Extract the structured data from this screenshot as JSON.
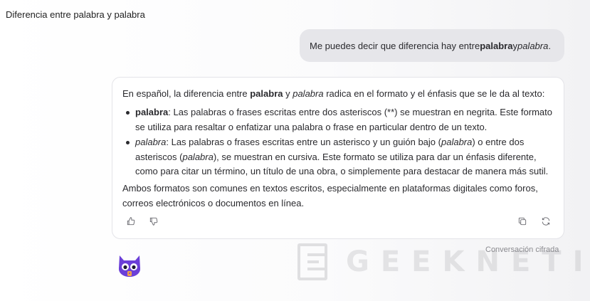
{
  "conversation": {
    "title": "Diferencia entre palabra y palabra"
  },
  "user_message": {
    "prefix": "Me puedes decir que diferencia hay entre ",
    "bold_word": "palabra",
    "middle": " y ",
    "italic_word": "palabra",
    "suffix": "."
  },
  "answer": {
    "intro": {
      "prefix": "En español, la diferencia entre ",
      "bold_word": "palabra",
      "middle": " y ",
      "italic_word": "palabra",
      "suffix": " radica en el formato y el énfasis que se le da al texto:"
    },
    "bullet_bold": {
      "term": "palabra",
      "text": ": Las palabras o frases escritas entre dos asteriscos (**) se muestran en negrita. Este formato se utiliza para resaltar o enfatizar una palabra o frase en particular dentro de un texto."
    },
    "bullet_italic": {
      "term": "palabra",
      "text_a": ": Las palabras o frases escritas entre un asterisco y un guión bajo (",
      "example_a": "palabra",
      "text_b": ") o entre dos asteriscos (",
      "example_b": "palabra",
      "text_c": "), se muestran en cursiva. Este formato se utiliza para dar un énfasis diferente, como para citar un término, un título de una obra, o simplemente para destacar de manera más sutil."
    },
    "closing": "Ambos formatos son comunes en textos escritos, especialmente en plataformas digitales como foros, correos electrónicos o documentos en línea."
  },
  "actions": {
    "thumbs_up": "thumbs-up-icon",
    "thumbs_down": "thumbs-down-icon",
    "copy": "copy-icon",
    "regenerate": "refresh-icon"
  },
  "status": {
    "encrypted": "Conversación cifrada"
  },
  "watermark": {
    "text": "GEEKNETIC"
  },
  "colors": {
    "user_bubble": "#e6e6ea",
    "avatar": "#6b3fd8",
    "text": "#2a2a2e"
  }
}
